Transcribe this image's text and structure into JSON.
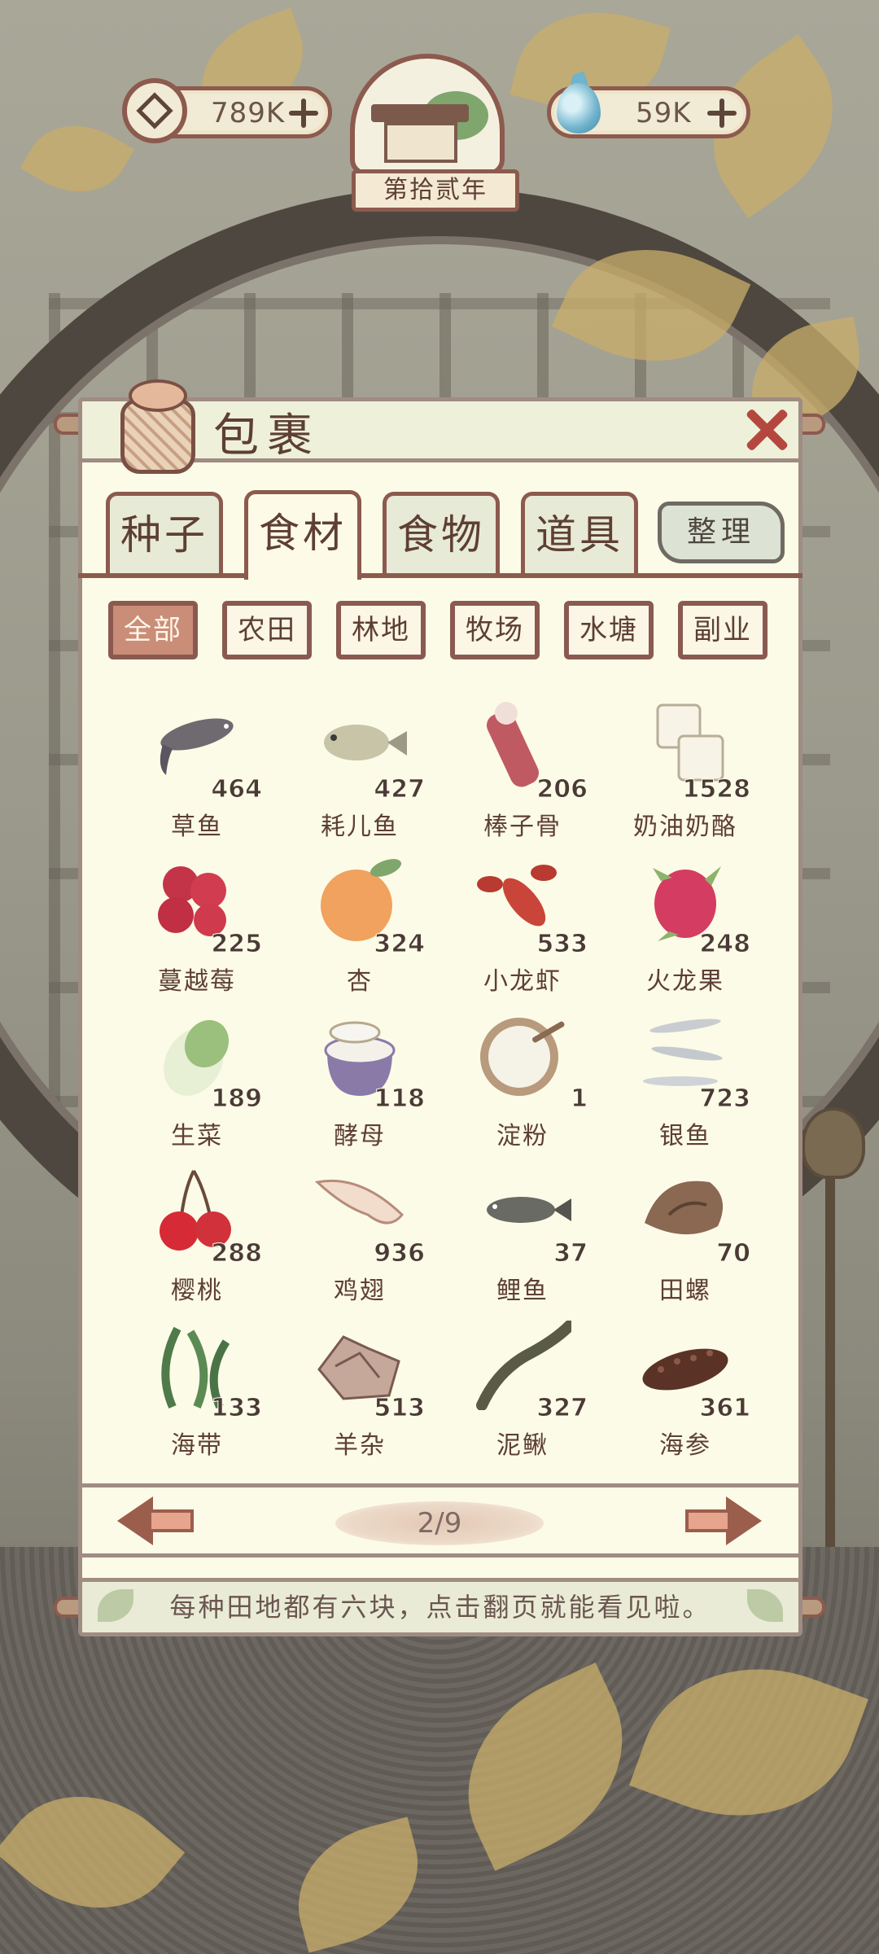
{
  "top_bar": {
    "coins": {
      "value": "789K",
      "icon": "square-hole-coin-icon"
    },
    "water": {
      "value": "59K",
      "icon": "water-drop-icon"
    },
    "year": "第拾贰年"
  },
  "panel": {
    "title": "包裹",
    "tabs": [
      {
        "label": "种子",
        "active": false
      },
      {
        "label": "食材",
        "active": true
      },
      {
        "label": "食物",
        "active": false
      },
      {
        "label": "道具",
        "active": false
      }
    ],
    "sort_button": "整理",
    "filters": [
      {
        "label": "全部",
        "active": true
      },
      {
        "label": "农田",
        "active": false
      },
      {
        "label": "林地",
        "active": false
      },
      {
        "label": "牧场",
        "active": false
      },
      {
        "label": "水塘",
        "active": false
      },
      {
        "label": "副业",
        "active": false
      }
    ],
    "items": [
      {
        "name": "草鱼",
        "count": "464",
        "icon": "fish-icon"
      },
      {
        "name": "耗儿鱼",
        "count": "427",
        "icon": "fish-icon"
      },
      {
        "name": "棒子骨",
        "count": "206",
        "icon": "bone-meat-icon"
      },
      {
        "name": "奶油奶酪",
        "count": "1528",
        "icon": "cheese-icon"
      },
      {
        "name": "蔓越莓",
        "count": "225",
        "icon": "cranberry-icon"
      },
      {
        "name": "杏",
        "count": "324",
        "icon": "apricot-icon"
      },
      {
        "name": "小龙虾",
        "count": "533",
        "icon": "crayfish-icon"
      },
      {
        "name": "火龙果",
        "count": "248",
        "icon": "dragonfruit-icon"
      },
      {
        "name": "生菜",
        "count": "189",
        "icon": "lettuce-icon"
      },
      {
        "name": "酵母",
        "count": "118",
        "icon": "yeast-jar-icon"
      },
      {
        "name": "淀粉",
        "count": "1",
        "icon": "starch-bowl-icon"
      },
      {
        "name": "银鱼",
        "count": "723",
        "icon": "silverfish-icon"
      },
      {
        "name": "樱桃",
        "count": "288",
        "icon": "cherry-icon"
      },
      {
        "name": "鸡翅",
        "count": "936",
        "icon": "chicken-wing-icon"
      },
      {
        "name": "鲤鱼",
        "count": "37",
        "icon": "carp-icon"
      },
      {
        "name": "田螺",
        "count": "70",
        "icon": "snail-icon"
      },
      {
        "name": "海带",
        "count": "133",
        "icon": "kelp-icon"
      },
      {
        "name": "羊杂",
        "count": "513",
        "icon": "lamb-offal-icon"
      },
      {
        "name": "泥鳅",
        "count": "327",
        "icon": "loach-icon"
      },
      {
        "name": "海参",
        "count": "361",
        "icon": "sea-cucumber-icon"
      }
    ],
    "pagination": {
      "current": 2,
      "total": 9,
      "text": "2/9"
    },
    "tip": "每种田地都有六块，点击翻页就能看见啦。"
  },
  "colors": {
    "panel_bg": "#fcfbe7",
    "frame_brown": "#8c5a4e",
    "text_brown": "#5e3f34",
    "close_red": "#b4483f",
    "active_filter": "#c98d78"
  }
}
